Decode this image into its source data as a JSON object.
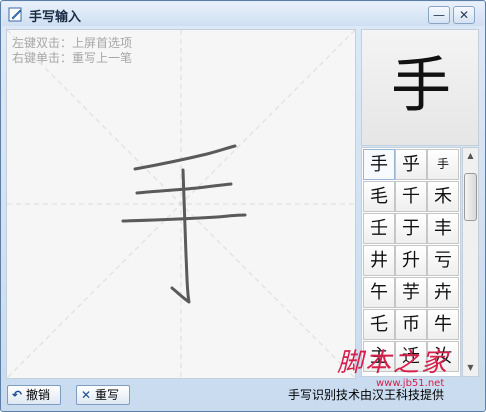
{
  "window": {
    "title": "手写输入"
  },
  "title_buttons": {
    "minimize": "—",
    "close": "✕"
  },
  "hints": {
    "left_click": "左键双击：上屏首选项",
    "right_click": "右键单击：重写上一笔"
  },
  "preview": {
    "character": "手"
  },
  "candidates": [
    "手",
    "乎",
    "手",
    "毛",
    "千",
    "禾",
    "壬",
    "于",
    "丰",
    "井",
    "升",
    "亏",
    "午",
    "芋",
    "卉",
    "乇",
    "币",
    "牛",
    "主",
    "迁",
    "汝"
  ],
  "buttons": {
    "undo": "撤销",
    "rewrite": "重写"
  },
  "credit": "手写识别技术由汉王科技提供",
  "watermark": {
    "text": "脚本之家",
    "sub": "www.jb51.net"
  },
  "icons": {
    "undo": "undo-arrow-icon",
    "rewrite": "x-icon",
    "app": "pen-pad-icon"
  },
  "colors": {
    "frame": "#5b7fa6",
    "watermark": "#d6204c",
    "ink": "#5a5a5a"
  }
}
